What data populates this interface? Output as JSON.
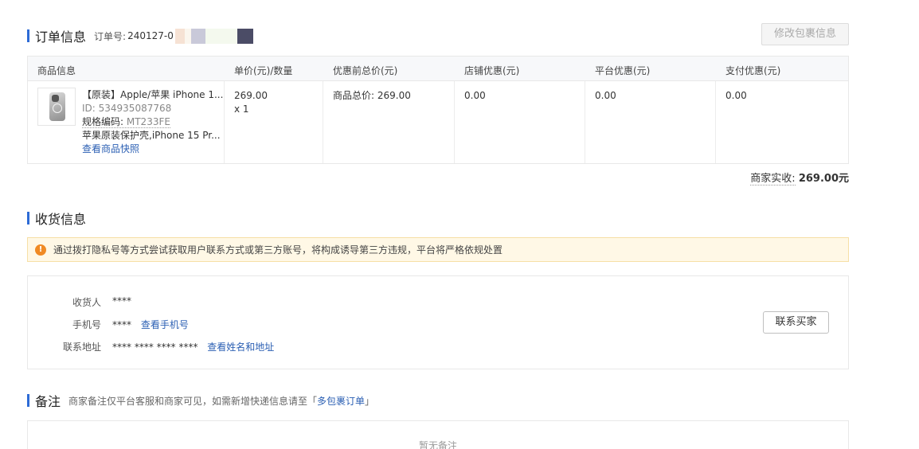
{
  "order": {
    "title": "订单信息",
    "order_no_label": "订单号:",
    "order_no": "240127-0",
    "edit_button": "修改包裹信息"
  },
  "product_table": {
    "headers": [
      "商品信息",
      "单价(元)/数量",
      "优惠前总价(元)",
      "店铺优惠(元)",
      "平台优惠(元)",
      "支付优惠(元)"
    ],
    "product": {
      "name": "【原装】Apple/苹果 iPhone 1...",
      "id": "ID: 534935087768",
      "spec_label": "规格编码:",
      "spec_code": "MT233FE",
      "desc": "苹果原装保护壳,iPhone 15 Pr...",
      "snapshot_link": "查看商品快照",
      "image_icon": "phone-case-image"
    },
    "unit_price": "269.00",
    "quantity": "x 1",
    "subtotal": "商品总价: 269.00",
    "shop_discount": "0.00",
    "platform_discount": "0.00",
    "payment_discount": "0.00"
  },
  "total": {
    "label": "商家实收:",
    "value": "269.00元"
  },
  "shipping": {
    "title": "收货信息",
    "warning": "通过拨打隐私号等方式尝试获取用户联系方式或第三方账号，将构成诱导第三方违规，平台将严格依规处置",
    "warning_icon": "exclamation-icon",
    "receiver_label": "收货人",
    "receiver_value": "****",
    "phone_label": "手机号",
    "phone_value": "****",
    "phone_link": "查看手机号",
    "address_label": "联系地址",
    "address_value": "**** **** **** ****",
    "address_link": "查看姓名和地址",
    "contact_button": "联系买家"
  },
  "notes": {
    "title": "备注",
    "subtitle_prefix": "商家备注仅平台客服和商家可见，如需新增快递信息请至「",
    "subtitle_link": "多包裹订单",
    "subtitle_suffix": "」",
    "empty_text": "暂无备注"
  },
  "colors": {
    "accent_bar": "#2d6bd6",
    "link": "#2b5fb3",
    "warning_bg": "#fff8e6",
    "warning_icon": "#f08a24"
  }
}
